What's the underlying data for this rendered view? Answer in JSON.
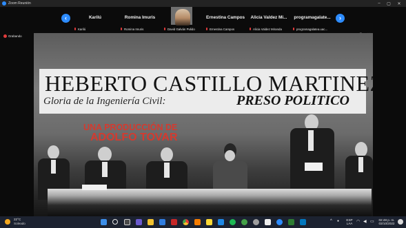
{
  "window": {
    "title": "Zoom Reunión",
    "minimize": "–",
    "maximize": "▢",
    "close": "✕"
  },
  "strip": {
    "prev": "‹",
    "next": "›",
    "tiles": [
      {
        "big": "Karilú",
        "small": "Karilú"
      },
      {
        "big": "Romina Imuris",
        "small": "Romina Imuris"
      },
      {
        "big": "",
        "small": "David Galván Pulido"
      },
      {
        "big": "Ernestina Campos",
        "small": "Ernestina Campos"
      },
      {
        "big": "Alicia Valdez Mi...",
        "small": "Alicia Valdez Miranda"
      },
      {
        "big": "programagalate...",
        "small": "programagalatea.uac..."
      }
    ]
  },
  "share": {
    "recording": "Grabando",
    "banner_line1": "HEBERTO CASTILLO MARTINEZ",
    "banner_line2": "Gloria de la Ingeniería Civil:",
    "banner_line3": "PRESO POLITICO",
    "credit_line1": "UNA PRODUCCIÓN DE",
    "credit_line2": "ADOLFO TOVAR"
  },
  "taskbar": {
    "temperature": "22°C",
    "condition": "Soleado",
    "language": "ESP",
    "layout": "LAA",
    "time": "02:48 p. m.",
    "date": "03/10/2022",
    "accent": "#1c2230"
  }
}
